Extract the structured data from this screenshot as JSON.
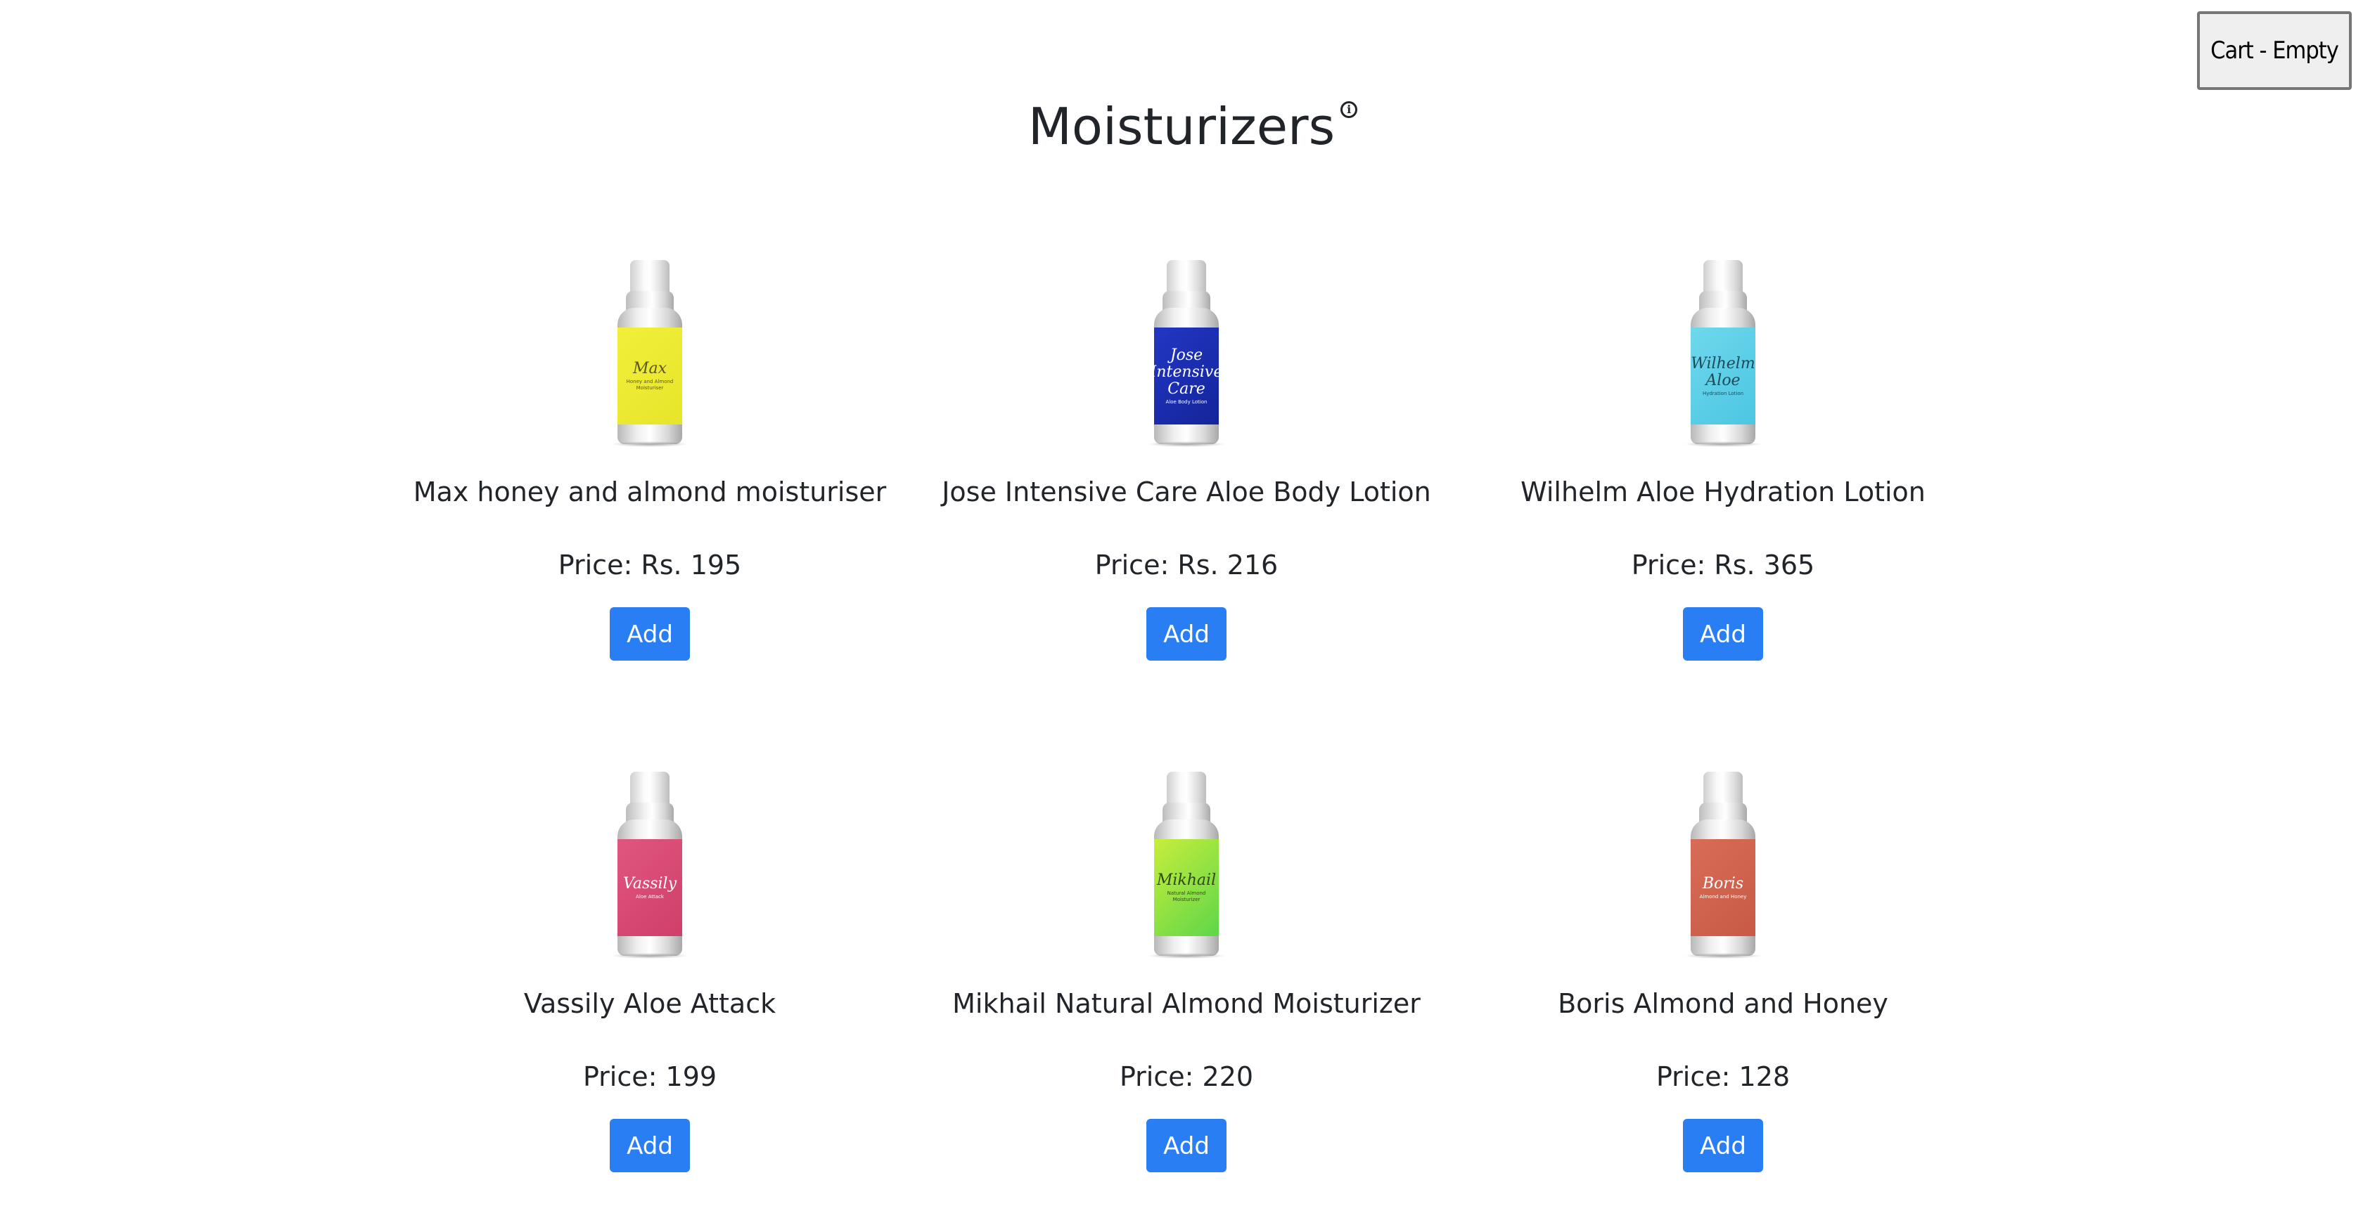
{
  "cart": {
    "label": "Cart - Empty"
  },
  "page": {
    "title": "Moisturizers",
    "info_symbol": "i"
  },
  "products": [
    {
      "name": "Max honey and almond moisturiser",
      "price": "Price: Rs. 195",
      "add_label": "Add",
      "bottle": {
        "color": "#f2ef3a",
        "color2": "#e6e52a",
        "brand": "Max",
        "subtitle": "Honey and Almond Moisturiser",
        "text_color": "#5a5a1a"
      }
    },
    {
      "name": "Jose Intensive Care Aloe Body Lotion",
      "price": "Price: Rs. 216",
      "add_label": "Add",
      "bottle": {
        "color": "#2137c4",
        "color2": "#15249a",
        "brand": "Jose Intensive Care",
        "subtitle": "Aloe Body Lotion",
        "text_color": "#ffffff"
      }
    },
    {
      "name": "Wilhelm Aloe Hydration Lotion",
      "price": "Price: Rs. 365",
      "add_label": "Add",
      "bottle": {
        "color": "#6fd8ec",
        "color2": "#4cc6e3",
        "brand": "Wilhelm Aloe",
        "subtitle": "Hydration Lotion",
        "text_color": "#1f4a5a"
      }
    },
    {
      "name": "Vassily Aloe Attack",
      "price": "Price: 199",
      "add_label": "Add",
      "bottle": {
        "color": "#e0567e",
        "color2": "#cf3f6a",
        "brand": "Vassily",
        "subtitle": "Aloe Attack",
        "text_color": "#ffffff"
      }
    },
    {
      "name": "Mikhail Natural Almond Moisturizer",
      "price": "Price: 220",
      "add_label": "Add",
      "bottle": {
        "color": "#c7ee3a",
        "color2": "#5ed64a",
        "brand": "Mikhail",
        "subtitle": "Natural Almond Moisturizer",
        "text_color": "#2f4a12"
      }
    },
    {
      "name": "Boris Almond and Honey",
      "price": "Price: 128",
      "add_label": "Add",
      "bottle": {
        "color": "#d86c57",
        "color2": "#c85a45",
        "brand": "Boris",
        "subtitle": "Almond and Honey",
        "text_color": "#ffffff"
      }
    }
  ]
}
